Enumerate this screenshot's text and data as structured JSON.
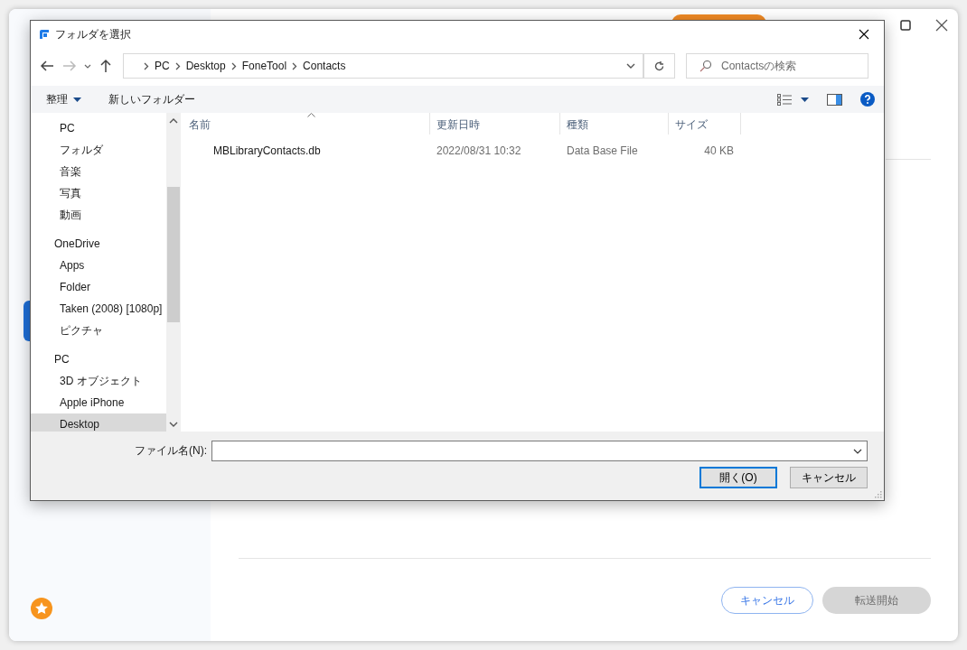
{
  "app": {
    "buttons": [
      {
        "label": "キャンセル",
        "kind": "outline",
        "disabled": false
      },
      {
        "label": "転送開始",
        "kind": "primary",
        "disabled": true
      }
    ]
  },
  "dialog": {
    "title": "フォルダを選択",
    "breadcrumb": [
      "PC",
      "Desktop",
      "FoneTool",
      "Contacts"
    ],
    "search": {
      "placeholder": "Contactsの検索"
    },
    "toolbar": {
      "organize": "整理",
      "new_folder": "新しいフォルダー"
    },
    "nav_tree": [
      {
        "children": [
          {
            "label": "PC",
            "selected": false
          },
          {
            "label": "フォルダ",
            "selected": false
          },
          {
            "label": "音楽",
            "selected": false
          },
          {
            "label": "写真",
            "selected": false
          },
          {
            "label": "動画",
            "selected": false
          }
        ]
      },
      {
        "label": "OneDrive",
        "selected": false,
        "children": [
          {
            "label": "Apps",
            "selected": false
          },
          {
            "label": "Folder",
            "selected": false
          },
          {
            "label": "Taken (2008) [1080p]",
            "selected": false
          },
          {
            "label": "ピクチャ",
            "selected": false
          }
        ]
      },
      {
        "label": "PC",
        "selected": false,
        "children": [
          {
            "label": "3D オブジェクト",
            "selected": false
          },
          {
            "label": "Apple iPhone",
            "selected": false
          },
          {
            "label": "Desktop",
            "selected": true
          }
        ]
      }
    ],
    "columns": [
      {
        "label": "名前",
        "sorted": true
      },
      {
        "label": "更新日時",
        "sorted": false
      },
      {
        "label": "種類",
        "sorted": false
      },
      {
        "label": "サイズ",
        "sorted": false
      }
    ],
    "files": [
      {
        "name": "MBLibraryContacts.db",
        "modified": "2022/08/31 10:32",
        "type": "Data Base File",
        "size": "40 KB",
        "selected": false
      }
    ],
    "filename": {
      "label": "ファイル名(N):"
    },
    "buttons": [
      {
        "label": "開く(O)",
        "default": true
      },
      {
        "label": "キャンセル",
        "default": false
      }
    ]
  }
}
